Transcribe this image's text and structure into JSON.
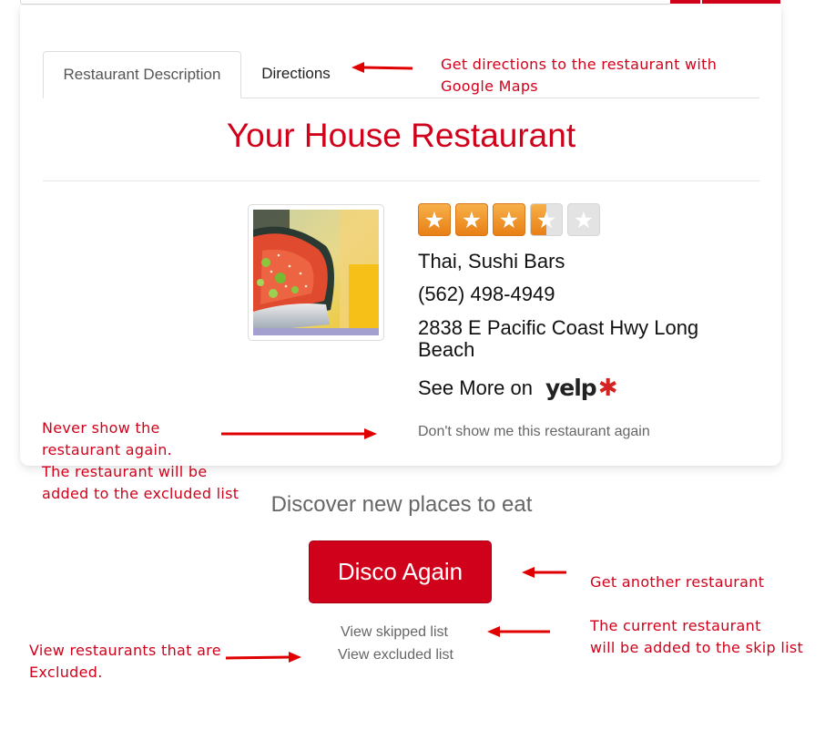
{
  "tabs": [
    {
      "label": "Restaurant Description",
      "active": true
    },
    {
      "label": "Directions",
      "active": false
    }
  ],
  "restaurant": {
    "name": "Your House Restaurant",
    "rating": 3.5,
    "rating_max": 5,
    "cuisine": "Thai, Sushi Bars",
    "phone": "(562) 498-4949",
    "address": "2838 E Pacific Coast Hwy Long Beach",
    "see_more_label": "See More on",
    "yelp_logo_text": "yelp",
    "dont_show_label": "Don't show me this restaurant again"
  },
  "discover": {
    "heading": "Discover new places to eat",
    "disco_button": "Disco Again",
    "skipped_link": "View skipped list",
    "excluded_link": "View excluded list"
  },
  "annotations": {
    "directions_note_1": "Get directions to the restaurant with",
    "directions_note_2": "Google Maps",
    "never_show_1": "Never show the",
    "never_show_2": "restaurant again.",
    "never_show_3": "The restaurant will be",
    "never_show_4": "added to the excluded list",
    "another_note": "Get another restaurant",
    "skip_note_1": "The current restaurant",
    "skip_note_2": "will be added to the skip list",
    "excluded_note_1": "View restaurants that are",
    "excluded_note_2": "Excluded."
  },
  "colors": {
    "accent": "#d0021b",
    "star": "#f39c2b",
    "muted_text": "#666666"
  }
}
